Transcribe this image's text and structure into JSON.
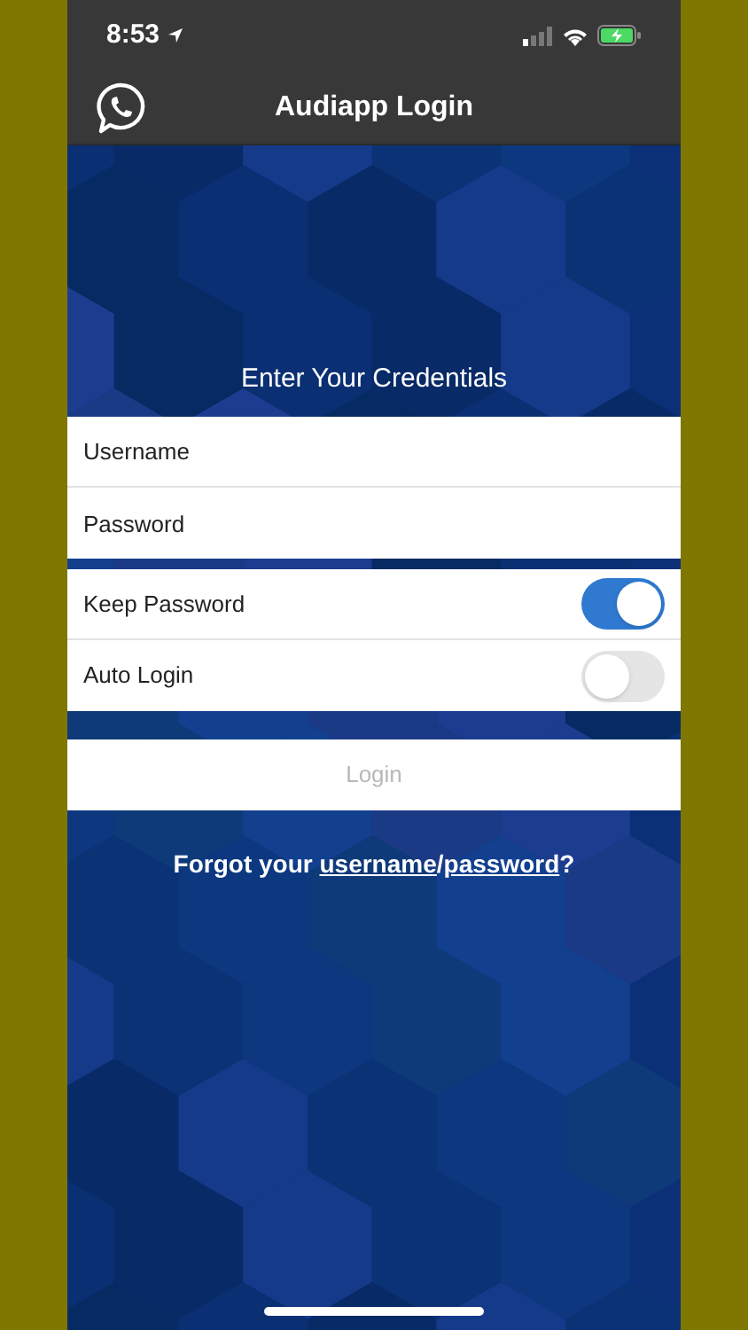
{
  "status_bar": {
    "time": "8:53"
  },
  "header": {
    "title": "Audiapp Login"
  },
  "form": {
    "heading": "Enter Your Credentials",
    "fields": [
      {
        "placeholder": "Username"
      },
      {
        "placeholder": "Password"
      }
    ],
    "options": [
      {
        "label": "Keep Password",
        "on": true
      },
      {
        "label": "Auto Login",
        "on": false
      }
    ],
    "login_button": {
      "label": "Login",
      "disabled": true
    }
  },
  "forgot": {
    "prefix": "Forgot your ",
    "links": [
      "username",
      "password"
    ],
    "separator": "/",
    "suffix": "?"
  }
}
